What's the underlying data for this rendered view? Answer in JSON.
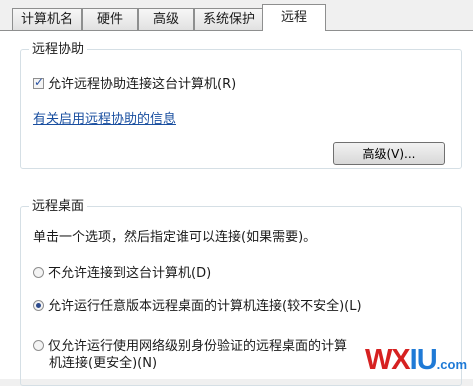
{
  "tabs": [
    {
      "label": "计算机名"
    },
    {
      "label": "硬件"
    },
    {
      "label": "高级"
    },
    {
      "label": "系统保护"
    },
    {
      "label": "远程",
      "active": true
    }
  ],
  "remote_assistance": {
    "title": "远程协助",
    "allow_checkbox": {
      "label": "允许远程协助连接这台计算机(R)",
      "checked": true
    },
    "info_link": "有关启用远程协助的信息",
    "advanced_button": "高级(V)..."
  },
  "remote_desktop": {
    "title": "远程桌面",
    "instruction": "单击一个选项，然后指定谁可以连接(如果需要)。",
    "options": [
      {
        "label": "不允许连接到这台计算机(D)",
        "selected": false
      },
      {
        "label": "允许运行任意版本远程桌面的计算机连接(较不安全)(L)",
        "selected": true
      },
      {
        "label_line1": "仅允许运行使用网络级别身份验证的远程桌面的计算",
        "label_line2": "机连接(更安全)(N)",
        "selected": false
      }
    ]
  },
  "watermark": {
    "red": "WX",
    "blue": "IU",
    "suffix": ".com"
  }
}
